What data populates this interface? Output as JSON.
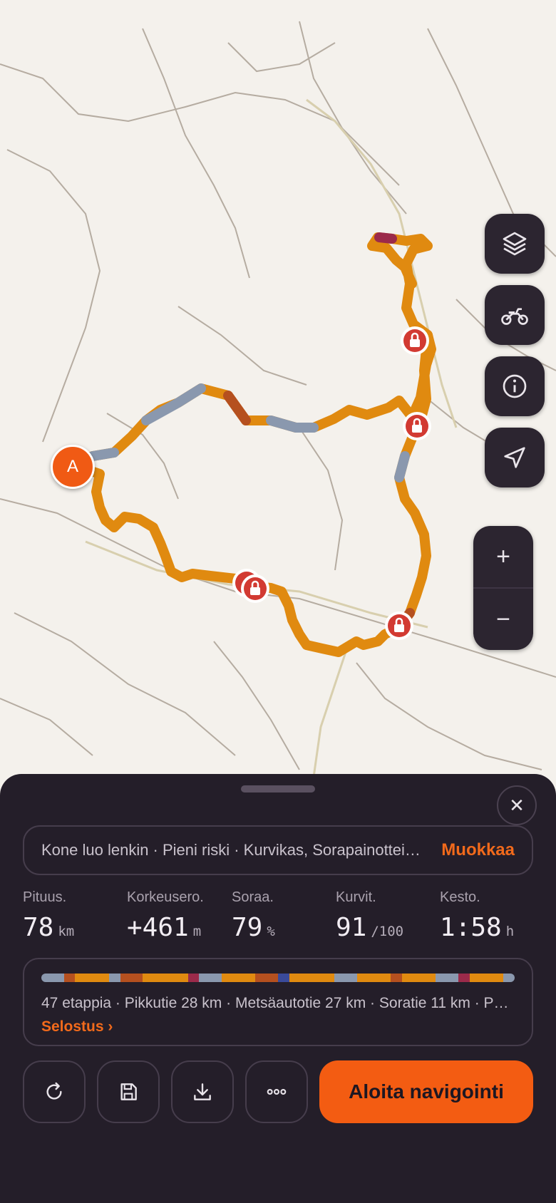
{
  "map": {
    "start_marker_label": "A",
    "route_color": "#e08a10",
    "lock_marker_color": "#d23a32"
  },
  "map_controls": {
    "layers_icon": "layers-icon",
    "vehicle_icon": "motorbike-icon",
    "info_icon": "info-icon",
    "locate_icon": "navigation-arrow-icon",
    "zoom_in": "+",
    "zoom_out": "−"
  },
  "sheet": {
    "close_symbol": "✕",
    "summary": "Kone luo lenkin · Pieni riski · Kurvikas, Sorapainotteinen",
    "edit_label": "Muokkaa",
    "stats": [
      {
        "label": "Pituus.",
        "value": "78",
        "unit": "km"
      },
      {
        "label": "Korkeusero.",
        "value": "+461",
        "unit": "m"
      },
      {
        "label": "Soraa.",
        "value": "79",
        "unit": "%"
      },
      {
        "label": "Kurvit.",
        "value": "91",
        "unit": "/100"
      },
      {
        "label": "Kesto.",
        "value": "1:58",
        "unit": "h"
      }
    ],
    "segments_text": "47 etappia · Pikkutie 28 km · Metsäautotie 27 km · Soratie 11 km · P…",
    "segments_link": "Selostus ›",
    "actions": {
      "reroute_icon": "refresh-icon",
      "save_icon": "save-icon",
      "download_icon": "download-icon",
      "more_icon": "more-icon"
    },
    "start_label": "Aloita navigointi",
    "accent_color": "#f35c12"
  }
}
